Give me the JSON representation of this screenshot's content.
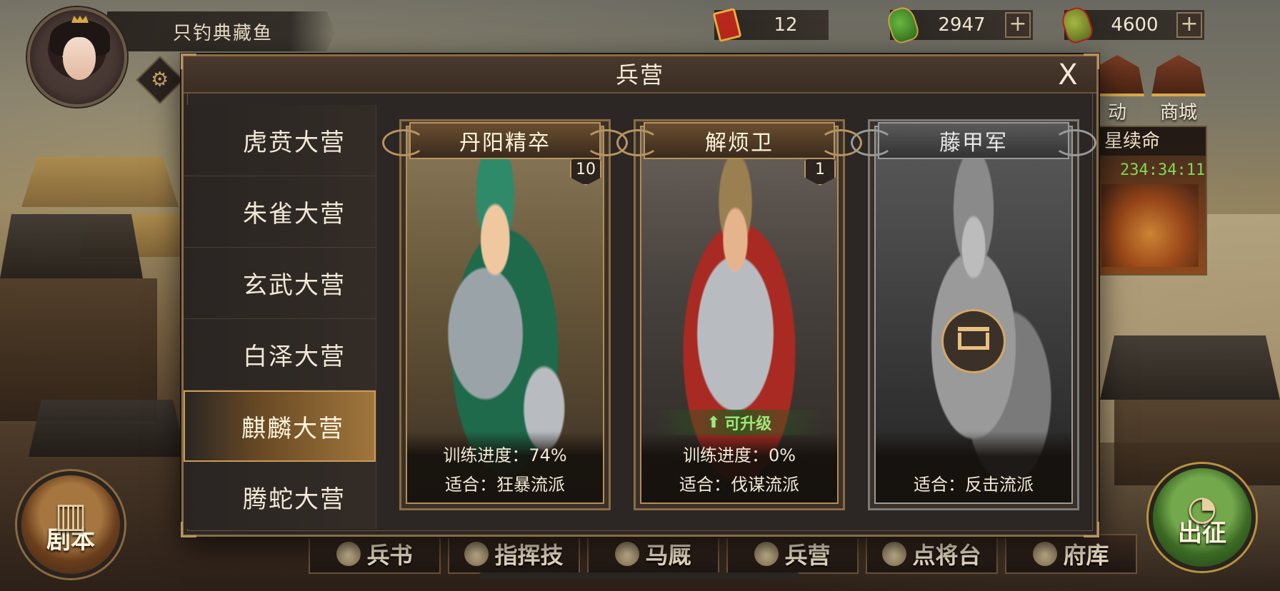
{
  "player": {
    "name": "只钓典藏鱼"
  },
  "resources": [
    {
      "icon": "command-token-icon",
      "value": "12",
      "has_plus": false
    },
    {
      "icon": "jade-icon",
      "value": "2947",
      "has_plus": true,
      "plus": "+"
    },
    {
      "icon": "gold-jade-icon",
      "value": "4600",
      "has_plus": true,
      "plus": "+"
    }
  ],
  "side_menu": {
    "event_label": "动",
    "shop_label": "商城"
  },
  "event": {
    "title": "星续命",
    "timer": "234:34:11"
  },
  "bottom": {
    "script_label": "剧本",
    "march_label": "出征",
    "tabs": [
      "兵书",
      "指挥技",
      "马厩",
      "兵营",
      "点将台",
      "府库"
    ]
  },
  "modal": {
    "title": "兵营",
    "close_label": "X",
    "categories": [
      "虎贲大营",
      "朱雀大营",
      "玄武大营",
      "白泽大营",
      "麒麟大营",
      "腾蛇大营"
    ],
    "active_category_index": 4,
    "cards": [
      {
        "name": "丹阳精卒",
        "level": "10",
        "progress": "训练进度：74%",
        "suit": "适合：狂暴流派",
        "locked": false,
        "upgradable": false
      },
      {
        "name": "解烦卫",
        "level": "1",
        "progress": "训练进度：0%",
        "suit": "适合：伐谋流派",
        "locked": false,
        "upgradable": true,
        "upgrade_label": "可升级"
      },
      {
        "name": "藤甲军",
        "level": "",
        "progress": "",
        "suit": "适合：反击流派",
        "locked": true,
        "upgradable": false
      }
    ]
  }
}
